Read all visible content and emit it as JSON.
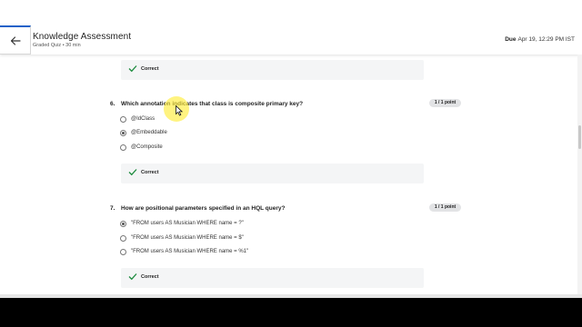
{
  "header": {
    "title": "Knowledge Assessment",
    "subtitle": "Graded Quiz • 30 min",
    "due_label": "Due",
    "due_value": "Apr 19, 12:29 PM IST"
  },
  "prev_feedback": {
    "label": "Correct"
  },
  "questions": [
    {
      "number": "6.",
      "text": "Which annotation indicates that class is composite primary key?",
      "points": "1 / 1 point",
      "options": [
        {
          "label": "@IdClass",
          "selected": false
        },
        {
          "label": "@Embeddable",
          "selected": true
        },
        {
          "label": "@Composite",
          "selected": false
        }
      ],
      "feedback": "Correct"
    },
    {
      "number": "7.",
      "text": "How are positional parameters specified in an HQL query?",
      "points": "1 / 1 point",
      "options": [
        {
          "label": "\"FROM users AS Musician WHERE name = ?\"",
          "selected": true
        },
        {
          "label": "\"FROM users AS Musician WHERE name = $\"",
          "selected": false
        },
        {
          "label": "\"FROM users AS Musician WHERE name = %1\"",
          "selected": false
        }
      ],
      "feedback": "Correct"
    }
  ],
  "colors": {
    "accent": "#1f62c8",
    "check": "#1a8a3c",
    "highlight": "#ffec3c"
  },
  "icons": {
    "back": "arrow-left-icon",
    "check": "check-icon",
    "cursor": "mouse-pointer-icon"
  }
}
